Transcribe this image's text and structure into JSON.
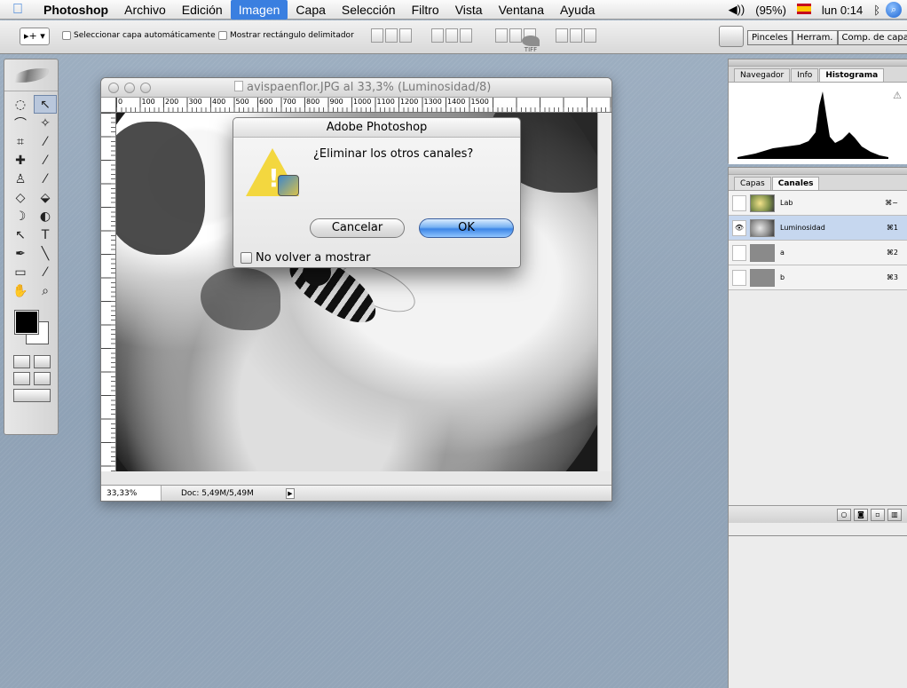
{
  "menubar": {
    "app": "Photoshop",
    "items": [
      "Archivo",
      "Edición",
      "Imagen",
      "Capa",
      "Selección",
      "Filtro",
      "Vista",
      "Ventana",
      "Ayuda"
    ],
    "active_item": "Imagen",
    "volume": "◀))",
    "battery": "(95%)",
    "clock": "lun 0:14"
  },
  "options_bar": {
    "tool_preset": "▸+ ▾",
    "auto_select": "Seleccionar capa automáticamente",
    "show_bounds": "Mostrar rectángulo delimitador",
    "palette_well": [
      "Pinceles",
      "Herram.",
      "Comp. de capas"
    ],
    "tiff_label": "TIFF"
  },
  "tools": {
    "icons": [
      "marquee-icon",
      "move-icon",
      "lasso-icon",
      "magic-wand-icon",
      "crop-icon",
      "slice-icon",
      "healing-icon",
      "brush-icon",
      "stamp-icon",
      "history-brush-icon",
      "eraser-icon",
      "bucket-icon",
      "blur-icon",
      "dodge-icon",
      "path-select-icon",
      "type-icon",
      "pen-icon",
      "line-icon",
      "notes-icon",
      "eyedropper-icon",
      "hand-icon",
      "zoom-icon"
    ],
    "glyphs": [
      "◌",
      "↖",
      "⌒",
      "✧",
      "⌗",
      "⁄",
      "✚",
      "⁄",
      "♙",
      "⁄",
      "◇",
      "⬙",
      "☽",
      "◐",
      "↖",
      "T",
      "✒",
      "╲",
      "▭",
      "⁄",
      "✋",
      "⌕"
    ]
  },
  "document": {
    "title": "avispaenflor.JPG al 33,3% (Luminosidad/8)",
    "ruler_labels": [
      "0",
      "100",
      "200",
      "300",
      "400",
      "500",
      "600",
      "700",
      "800",
      "900",
      "1000",
      "1100",
      "1200",
      "1300",
      "1400",
      "1500"
    ],
    "zoom": "33,33%",
    "doc_size": "Doc: 5,49M/5,49M"
  },
  "dialog": {
    "title": "Adobe Photoshop",
    "message": "¿Eliminar los otros canales?",
    "cancel_label": "Cancelar",
    "ok_label": "OK",
    "dont_show_label": "No volver a mostrar"
  },
  "histogram_palette": {
    "tabs": [
      "Navegador",
      "Info",
      "Histograma"
    ],
    "active_tab": "Histograma"
  },
  "channels_palette": {
    "tabs": [
      "Capas",
      "Canales"
    ],
    "active_tab": "Canales",
    "channels": [
      {
        "name": "Lab",
        "shortcut": "⌘~",
        "visible": false,
        "selected": false,
        "thumb": "color"
      },
      {
        "name": "Luminosidad",
        "shortcut": "⌘1",
        "visible": true,
        "selected": true,
        "thumb": "gray"
      },
      {
        "name": "a",
        "shortcut": "⌘2",
        "visible": false,
        "selected": false,
        "thumb": "flat"
      },
      {
        "name": "b",
        "shortcut": "⌘3",
        "visible": false,
        "selected": false,
        "thumb": "flat"
      }
    ]
  },
  "colors": {
    "menu_highlight": "#3a7fe0",
    "desktop": "#93a5b8",
    "selected_channel": "#c6d7ef",
    "ok_button": "#3d86e6"
  }
}
